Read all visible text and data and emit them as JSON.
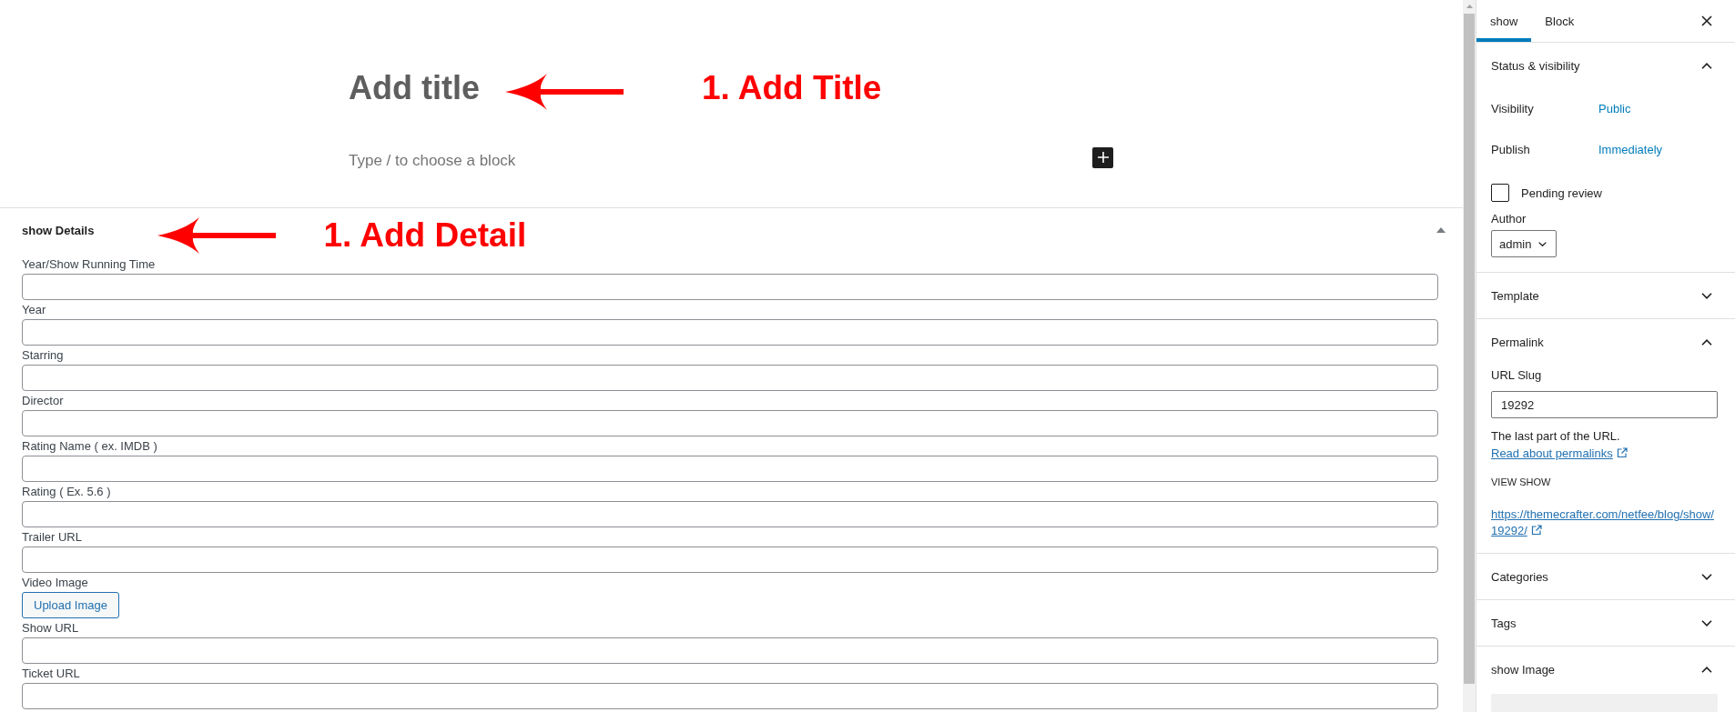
{
  "editor": {
    "title": {
      "placeholder": "Add title",
      "annotation": "1. Add Title"
    },
    "block": {
      "placeholder": "Type / to choose a block"
    }
  },
  "metabox": {
    "title": "show Details",
    "expanded": true,
    "annotation": "1. Add Detail",
    "fields": [
      {
        "kind": "text",
        "label": "Year/Show Running Time"
      },
      {
        "kind": "text",
        "label": "Year"
      },
      {
        "kind": "text",
        "label": "Starring"
      },
      {
        "kind": "text",
        "label": "Director"
      },
      {
        "kind": "text",
        "label": "Rating Name ( ex. IMDB )"
      },
      {
        "kind": "text",
        "label": "Rating ( Ex. 5.6 )"
      },
      {
        "kind": "text",
        "label": "Trailer URL"
      },
      {
        "kind": "upload",
        "label": "Video Image",
        "button": "Upload Image"
      },
      {
        "kind": "text",
        "label": "Show URL"
      },
      {
        "kind": "text",
        "label": "Ticket URL"
      }
    ]
  },
  "sidebar": {
    "tabs": [
      {
        "label": "show",
        "selected": true
      },
      {
        "label": "Block",
        "selected": false
      }
    ],
    "panels": [
      {
        "kind": "status",
        "title": "Status & visibility",
        "expanded": true,
        "rows": [
          {
            "label": "Visibility",
            "value": "Public"
          },
          {
            "label": "Publish",
            "value": "Immediately"
          }
        ],
        "checkbox": {
          "label": "Pending review",
          "checked": false
        },
        "author": {
          "label": "Author",
          "value": "admin"
        }
      },
      {
        "title": "Template",
        "expanded": false
      },
      {
        "kind": "permalink",
        "title": "Permalink",
        "expanded": true,
        "slug_label": "URL Slug",
        "slug": "19292",
        "help": "The last part of the URL.",
        "help_link": "Read about permalinks",
        "view_label": "VIEW SHOW",
        "url": "https://themecrafter.com/netfee/blog/show/19292/"
      },
      {
        "title": "Categories",
        "expanded": false
      },
      {
        "title": "Tags",
        "expanded": false
      },
      {
        "kind": "image",
        "title": "show Image",
        "expanded": true
      }
    ]
  }
}
